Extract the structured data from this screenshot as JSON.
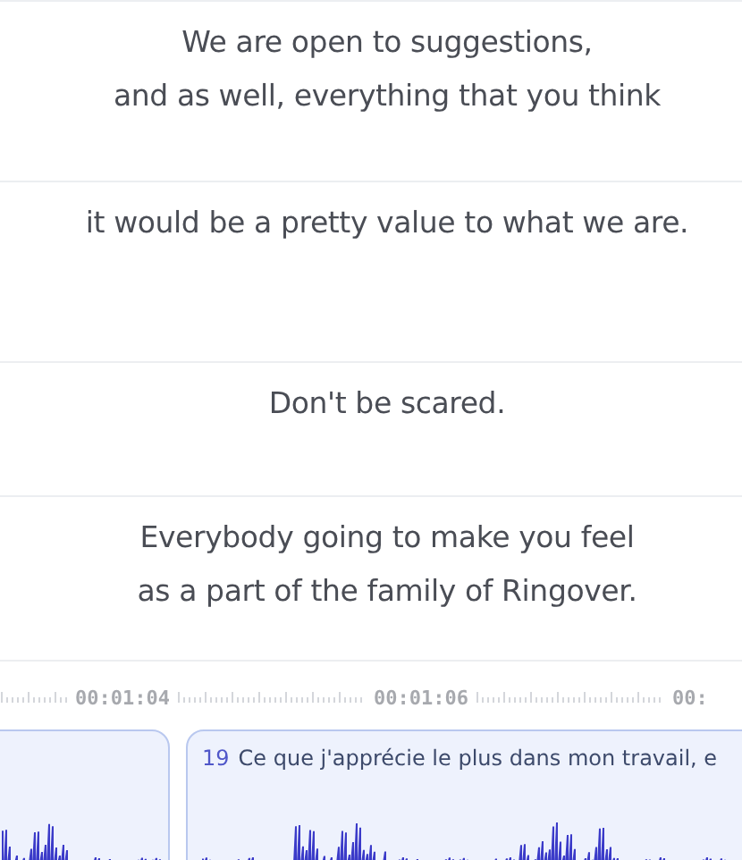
{
  "subtitles": [
    {
      "lines": [
        "We are open to suggestions,",
        "and as well, everything that you think"
      ]
    },
    {
      "lines": [
        "it would be a pretty value to what we are."
      ]
    },
    {
      "lines": [
        "Don't be scared."
      ]
    },
    {
      "lines": [
        "Everybody going to make you feel",
        "as a part of the family of Ringover."
      ]
    }
  ],
  "timeline": {
    "timecodes": [
      "00:01:04",
      "00:01:06",
      "00:"
    ]
  },
  "clips": [
    {
      "kind": "plain"
    },
    {
      "kind": "captioned",
      "number": "19",
      "text": "Ce que j'apprécie le plus dans mon travail, e"
    }
  ]
}
